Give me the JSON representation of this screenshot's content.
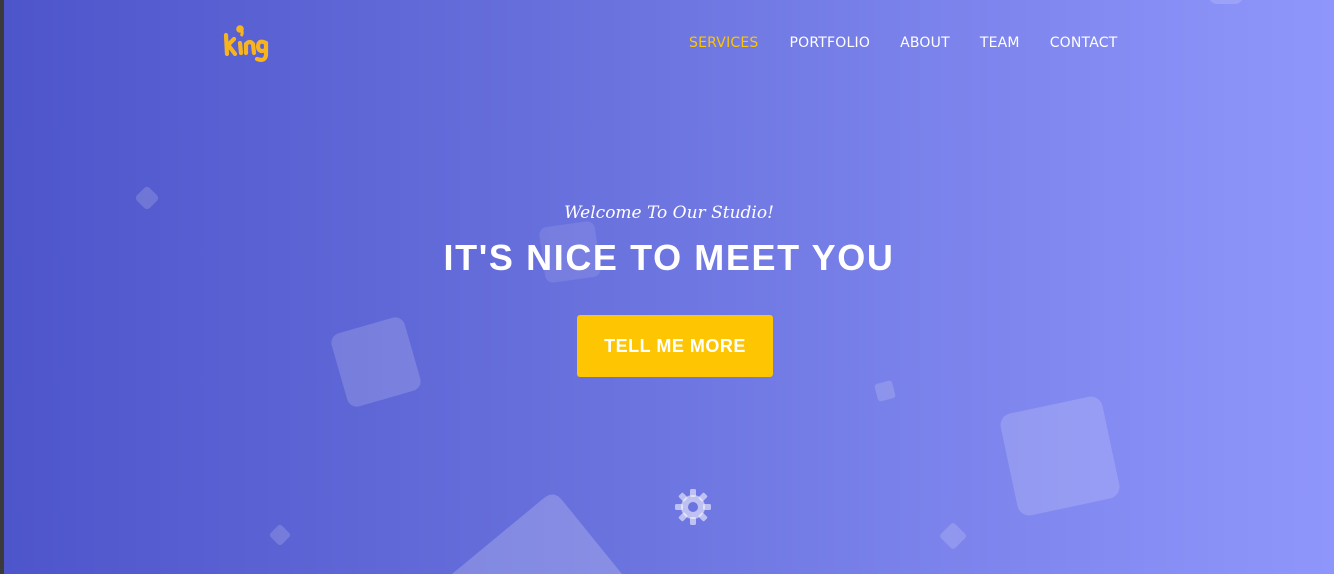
{
  "brand": {
    "logo_text": "king",
    "logo_color": "#f8b41f"
  },
  "nav": {
    "items": [
      {
        "label": "SERVICES",
        "active": true
      },
      {
        "label": "PORTFOLIO",
        "active": false
      },
      {
        "label": "ABOUT",
        "active": false
      },
      {
        "label": "TEAM",
        "active": false
      },
      {
        "label": "CONTACT",
        "active": false
      }
    ]
  },
  "hero": {
    "subtitle": "Welcome To Our Studio!",
    "headline": "IT'S NICE TO MEET YOU",
    "cta_label": "TELL ME MORE"
  },
  "colors": {
    "gradient_start": "#4e55cb",
    "gradient_end": "#8f96fb",
    "accent": "#fec503",
    "text": "#ffffff"
  },
  "icons": {
    "decoration": "gear-icon"
  }
}
